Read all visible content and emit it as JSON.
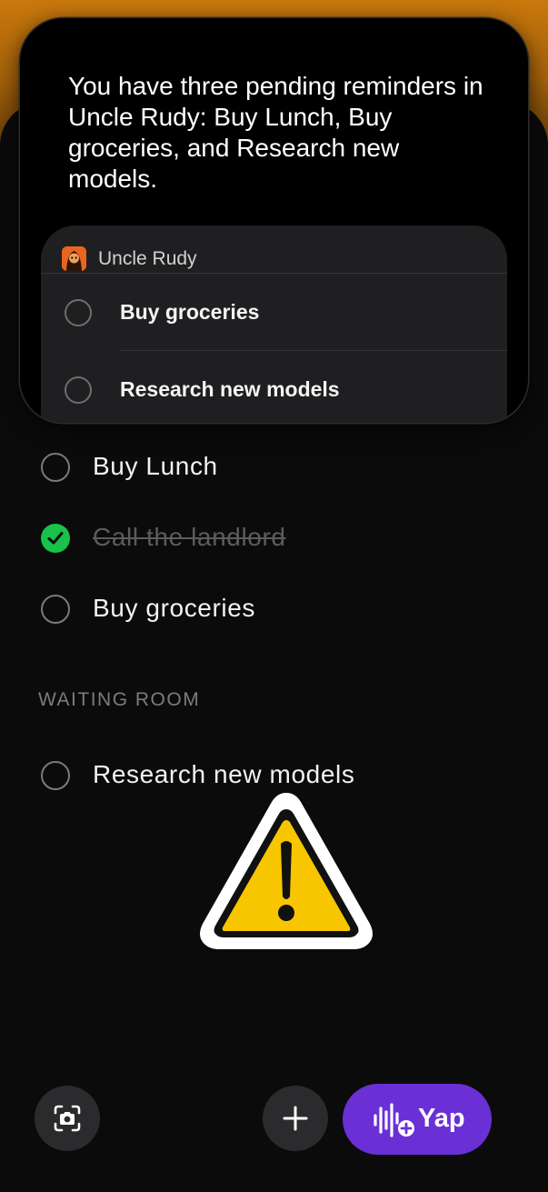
{
  "assistant_card": {
    "message": "You have three pending reminders in Uncle Rudy: Buy Lunch, Buy groceries, and Research new models.",
    "snippet": {
      "list_name": "Uncle Rudy",
      "items": [
        {
          "label": "Buy groceries",
          "completed": false
        },
        {
          "label": "Research new models",
          "completed": false
        }
      ]
    }
  },
  "reminders": {
    "items": [
      {
        "label": "Buy Lunch",
        "completed": false
      },
      {
        "label": "Call the landlord",
        "completed": true
      },
      {
        "label": "Buy groceries",
        "completed": false
      }
    ],
    "waiting_room": {
      "heading": "WAITING ROOM",
      "items": [
        {
          "label": "Research new models",
          "completed": false
        }
      ]
    }
  },
  "toolbar": {
    "camera_icon": "camera-scan-icon",
    "add_icon": "plus-icon",
    "yap_icon": "waveform-plus-icon",
    "yap_label": "Yap"
  },
  "overlay": {
    "icon": "warning-triangle-icon"
  },
  "colors": {
    "accent_purple": "#6a30d6",
    "complete_green": "#19c24a",
    "warning_yellow": "#f7c600"
  }
}
